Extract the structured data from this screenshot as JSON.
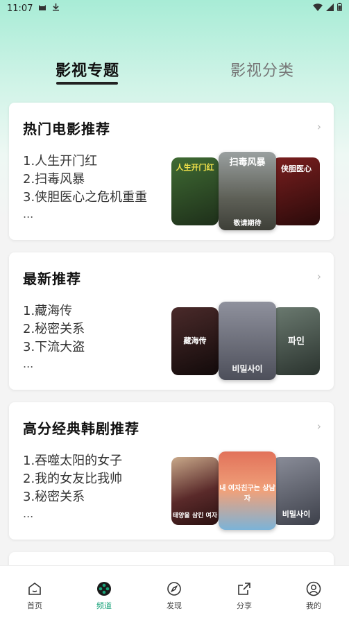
{
  "status_bar": {
    "time": "11:07",
    "icons": [
      "cat-icon",
      "download-icon",
      "wifi-icon",
      "signal-icon",
      "battery-icon"
    ]
  },
  "tabs": [
    {
      "label": "影视专题",
      "active": true
    },
    {
      "label": "影视分类",
      "active": false
    }
  ],
  "cards": [
    {
      "title": "热门电影推荐",
      "items": [
        "1.人生开门红",
        "2.扫毒风暴",
        "3.侠胆医心之危机重重"
      ],
      "more": "...",
      "posters": [
        {
          "name": "人生开门红",
          "color": "#2f4a2a"
        },
        {
          "name": "扫毒风暴",
          "color": "#6b6d63",
          "caption": "敬请期待"
        },
        {
          "name": "侠胆医心",
          "color": "#4a1515"
        }
      ]
    },
    {
      "title": "最新推荐",
      "items": [
        "1.藏海传",
        "2.秘密关系",
        "3.下流大盗"
      ],
      "more": "...",
      "posters": [
        {
          "name": "藏海传",
          "color": "#2a1f1f"
        },
        {
          "name": "비밀사이",
          "color": "#6a6b78"
        },
        {
          "name": "파인",
          "color": "#4c5a52"
        }
      ]
    },
    {
      "title": "高分经典韩剧推荐",
      "items": [
        "1.吞噬太阳的女子",
        "2.我的女友比我帅",
        "3.秘密关系"
      ],
      "more": "...",
      "posters": [
        {
          "name": "태양을 삼킨 여자",
          "color": "#5a2a2a"
        },
        {
          "name": "내 여자친구는 상남자",
          "color": "#d96a4a"
        },
        {
          "name": "비밀사이",
          "color": "#5a5f6e"
        }
      ]
    }
  ],
  "bottom_nav": [
    {
      "label": "首页",
      "icon": "home-icon",
      "active": false
    },
    {
      "label": "频道",
      "icon": "film-reel-icon",
      "active": true
    },
    {
      "label": "发现",
      "icon": "compass-icon",
      "active": false
    },
    {
      "label": "分享",
      "icon": "share-icon",
      "active": false
    },
    {
      "label": "我的",
      "icon": "user-icon",
      "active": false
    }
  ],
  "colors": {
    "accent": "#1aa37a",
    "gradient_top": "#a8ecd6"
  }
}
